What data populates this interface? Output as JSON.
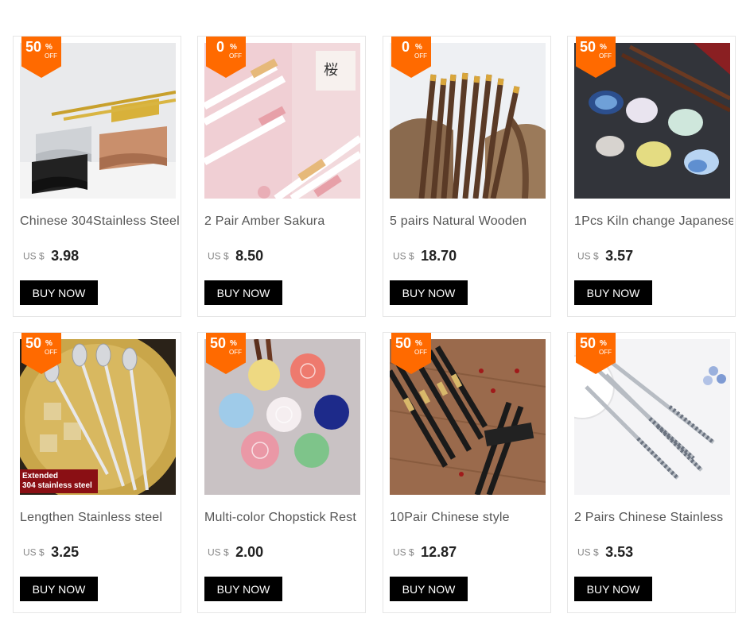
{
  "products": [
    {
      "title": "Chinese 304Stainless Steel",
      "currency": "US $",
      "price": "3.98",
      "discount_num": "50",
      "discount_pct": "%",
      "discount_off": "OFF",
      "button": "BUY NOW",
      "image": "steel-chopstick-rests"
    },
    {
      "title": "2 Pair Amber Sakura",
      "currency": "US $",
      "price": "8.50",
      "discount_num": "0",
      "discount_pct": "%",
      "discount_off": "OFF",
      "button": "BUY NOW",
      "image": "amber-sakura-chopsticks"
    },
    {
      "title": "5 pairs Natural Wooden",
      "currency": "US $",
      "price": "18.70",
      "discount_num": "0",
      "discount_pct": "%",
      "discount_off": "OFF",
      "button": "BUY NOW",
      "image": "wooden-chopsticks"
    },
    {
      "title": "1Pcs Kiln change Japanese",
      "currency": "US $",
      "price": "3.57",
      "discount_num": "50",
      "discount_pct": "%",
      "discount_off": "OFF",
      "button": "BUY NOW",
      "image": "ceramic-chopstick-rests"
    },
    {
      "title": "Lengthen Stainless steel",
      "currency": "US $",
      "price": "3.25",
      "discount_num": "50",
      "discount_pct": "%",
      "discount_off": "OFF",
      "button": "BUY NOW",
      "image": "long-spoons",
      "overlay_line1": "Extended",
      "overlay_line2": "304 stainless steel"
    },
    {
      "title": "Multi-color Chopstick Rest",
      "currency": "US $",
      "price": "2.00",
      "discount_num": "50",
      "discount_pct": "%",
      "discount_off": "OFF",
      "button": "BUY NOW",
      "image": "flower-chopstick-rests"
    },
    {
      "title": "10Pair Chinese style",
      "currency": "US $",
      "price": "12.87",
      "discount_num": "50",
      "discount_pct": "%",
      "discount_off": "OFF",
      "button": "BUY NOW",
      "image": "black-chopsticks"
    },
    {
      "title": "2 Pairs Chinese Stainless",
      "currency": "US $",
      "price": "3.53",
      "discount_num": "50",
      "discount_pct": "%",
      "discount_off": "OFF",
      "button": "BUY NOW",
      "image": "stainless-chopsticks"
    }
  ]
}
